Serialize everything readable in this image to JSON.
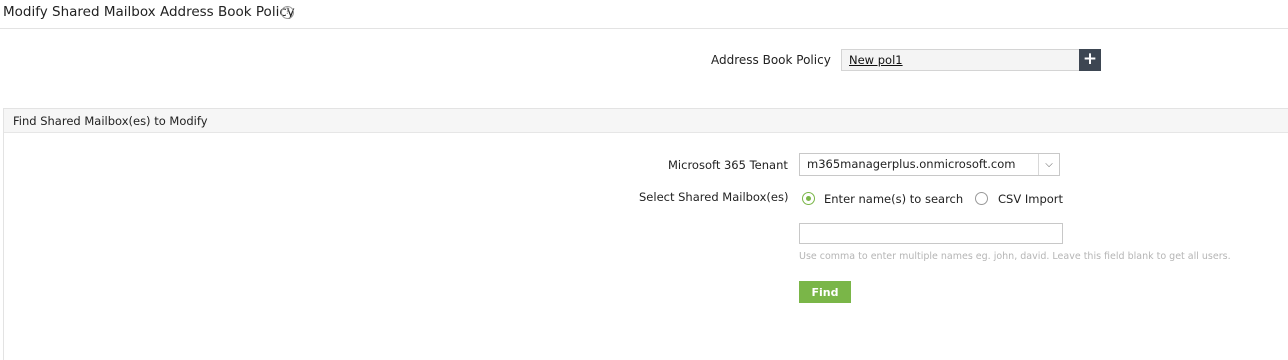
{
  "header": {
    "title": "Modify Shared Mailbox Address Book Policy",
    "help_icon": "question-circle",
    "help_glyph": "?"
  },
  "policy": {
    "label": "Address Book Policy",
    "value": "New pol1",
    "add_glyph": "+"
  },
  "find_panel": {
    "title": "Find Shared Mailbox(es) to Modify",
    "tenant_label": "Microsoft 365 Tenant",
    "tenant_value": "m365managerplus.onmicrosoft.com",
    "select_label": "Select Shared Mailbox(es)",
    "options": [
      {
        "label": "Enter name(s) to search",
        "selected": true
      },
      {
        "label": "CSV Import",
        "selected": false
      }
    ],
    "search_value": "",
    "hint": "Use comma to enter multiple names eg. john, david. Leave this field blank to get all users.",
    "find_label": "Find"
  },
  "colors": {
    "accent_green": "#7ab648",
    "dark_button": "#3d4652"
  }
}
